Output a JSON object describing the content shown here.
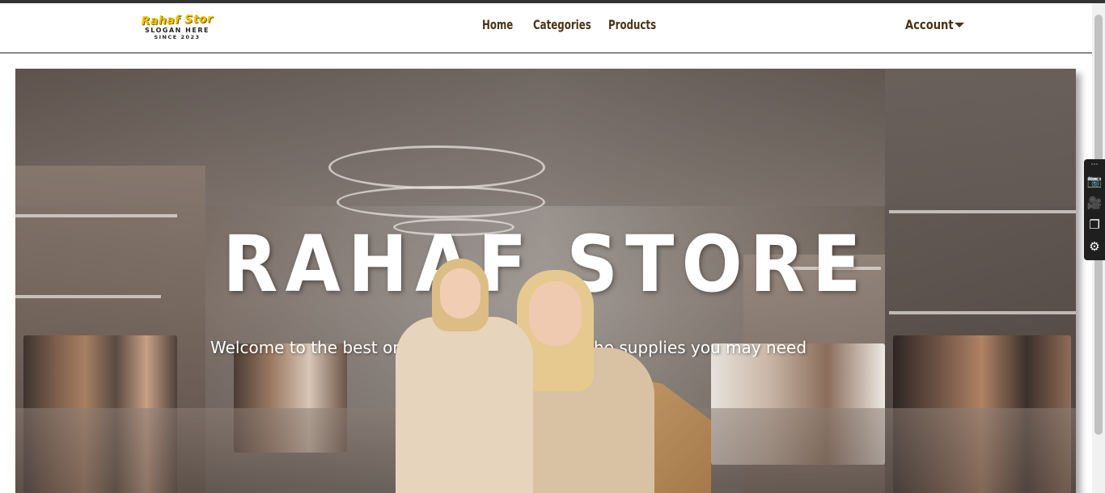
{
  "logo": {
    "brand": "Rahaf Stor",
    "slogan": "SLOGAN HERE",
    "since": "SINCE 2023"
  },
  "nav": {
    "links": [
      "Home",
      "Categories",
      "Products"
    ],
    "account_label": "Account"
  },
  "hero": {
    "title": "RAHAF STORE",
    "subtitle": "Welcome to the best online store. We have all the supplies you may need"
  },
  "side_toolbar": {
    "icons": [
      "link-more-icon",
      "camera-icon",
      "video-camera-icon",
      "window-icon",
      "gear-icon"
    ],
    "glyphs": [
      "⋯",
      "📷",
      "🎥",
      "❐",
      "⚙"
    ]
  },
  "colors": {
    "nav_text": "#4a3418",
    "logo_yellow": "#f2c300",
    "hero_text": "#ffffff"
  }
}
